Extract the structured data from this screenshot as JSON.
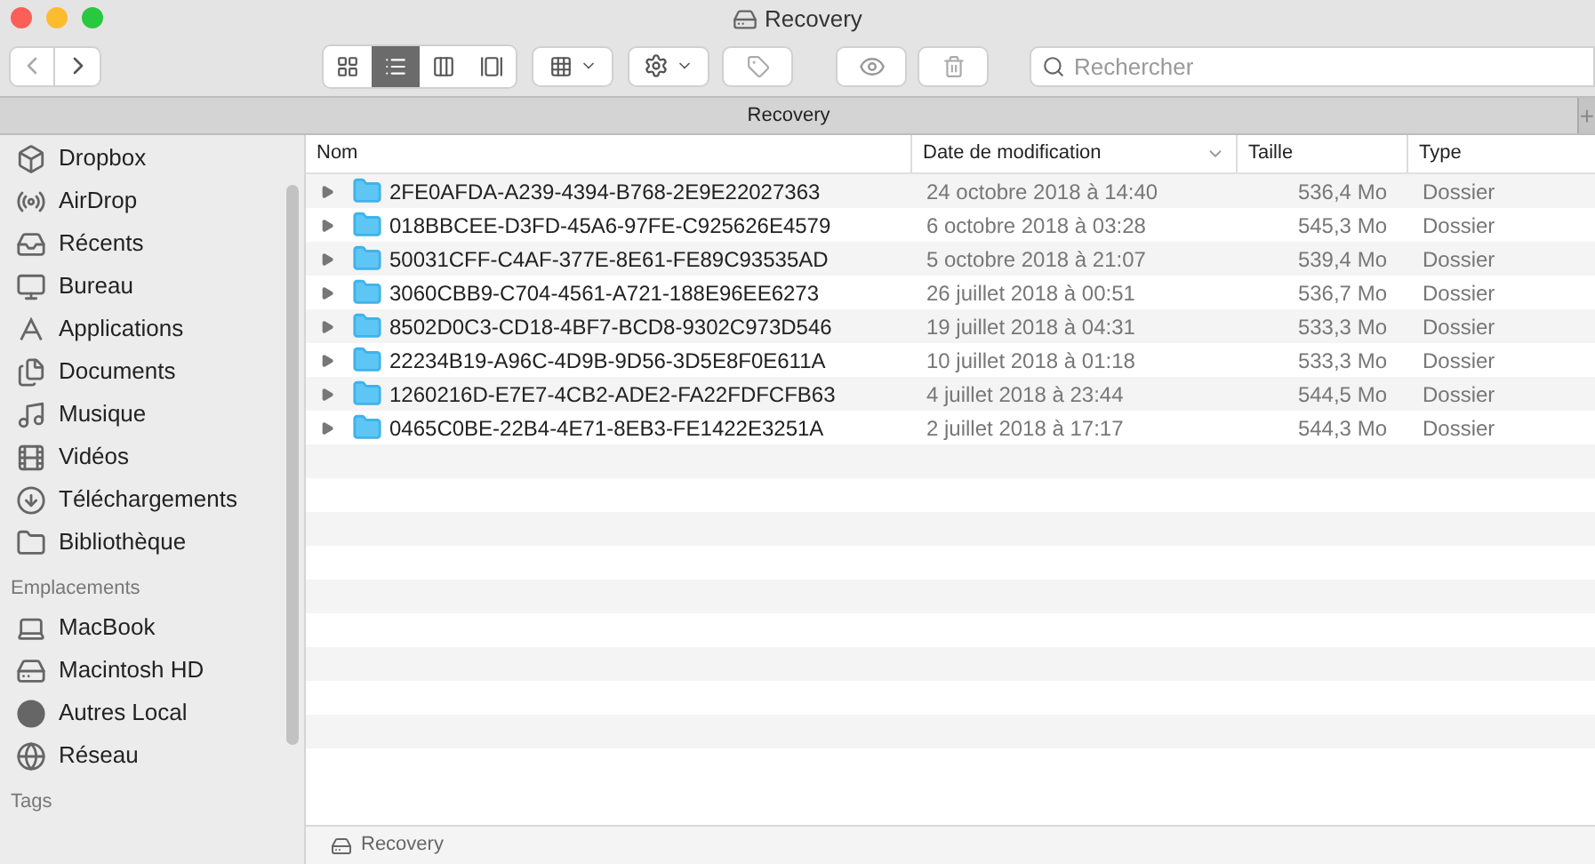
{
  "window": {
    "title": "Recovery"
  },
  "toolbar": {
    "view_modes": [
      {
        "selected": false
      },
      {
        "selected": true
      },
      {
        "selected": false
      },
      {
        "selected": false
      }
    ]
  },
  "search": {
    "placeholder": "Rechercher"
  },
  "tab": {
    "title": "Recovery",
    "add": "+"
  },
  "sidebar": {
    "sections": [
      {
        "items": [
          "Dropbox",
          "AirDrop",
          "Récents",
          "Bureau",
          "Applications",
          "Documents",
          "Musique",
          "Vidéos",
          "Téléchargements",
          "Bibliothèque"
        ]
      },
      {
        "heading": "Emplacements",
        "items": [
          "MacBook",
          "Macintosh HD",
          "Autres Local",
          "Réseau"
        ]
      },
      {
        "heading": "Tags"
      }
    ]
  },
  "table": {
    "columns": [
      {
        "label": "Nom",
        "sorted": false
      },
      {
        "label": "Date de modification",
        "sorted": true
      },
      {
        "label": "Taille",
        "sorted": false
      },
      {
        "label": "Type",
        "sorted": false
      }
    ],
    "rows": [
      {
        "name": "2FE0AFDA-A239-4394-B768-2E9E22027363",
        "date": "24 octobre 2018 à 14:40",
        "size": "536,4 Mo",
        "type": "Dossier",
        "expanded": false
      },
      {
        "name": "018BBCEE-D3FD-45A6-97FE-C925626E4579",
        "date": "6 octobre 2018 à 03:28",
        "size": "545,3 Mo",
        "type": "Dossier",
        "expanded": false
      },
      {
        "name": "50031CFF-C4AF-377E-8E61-FE89C93535AD",
        "date": "5 octobre 2018 à 21:07",
        "size": "539,4 Mo",
        "type": "Dossier",
        "expanded": false
      },
      {
        "name": "3060CBB9-C704-4561-A721-188E96EE6273",
        "date": "26 juillet 2018 à 00:51",
        "size": "536,7 Mo",
        "type": "Dossier",
        "expanded": false
      },
      {
        "name": "8502D0C3-CD18-4BF7-BCD8-9302C973D546",
        "date": "19 juillet 2018 à 04:31",
        "size": "533,3 Mo",
        "type": "Dossier",
        "expanded": false
      },
      {
        "name": "22234B19-A96C-4D9B-9D56-3D5E8F0E611A",
        "date": "10 juillet 2018 à 01:18",
        "size": "533,3 Mo",
        "type": "Dossier",
        "expanded": false
      },
      {
        "name": "1260216D-E7E7-4CB2-ADE2-FA22FDFCFB63",
        "date": "4 juillet 2018 à 23:44",
        "size": "544,5 Mo",
        "type": "Dossier",
        "expanded": false
      },
      {
        "name": "0465C0BE-22B4-4E71-8EB3-FE1422E3251A",
        "date": "2 juillet 2018 à 17:17",
        "size": "544,3 Mo",
        "type": "Dossier",
        "expanded": false
      }
    ]
  },
  "status_bar": {
    "path": "Recovery"
  }
}
